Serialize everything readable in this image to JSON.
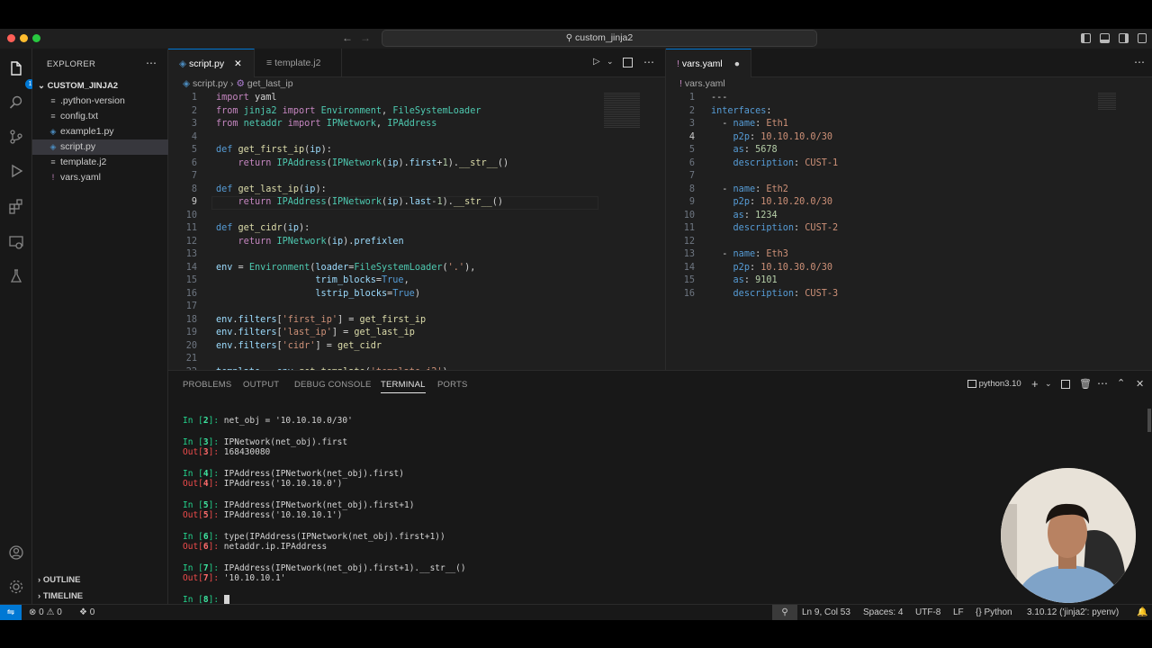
{
  "window": {
    "search_text": "custom_jinja2"
  },
  "explorer": {
    "title": "EXPLORER",
    "folder": "CUSTOM_JINJA2",
    "files": [
      ".python-version",
      "config.txt",
      "example1.py",
      "script.py",
      "template.j2",
      "vars.yaml"
    ],
    "selected": "script.py",
    "badge": "1",
    "outline": "OUTLINE",
    "timeline": "TIMELINE"
  },
  "left_editor": {
    "tabs": [
      "script.py",
      "template.j2"
    ],
    "breadcrumb_file": "script.py",
    "breadcrumb_symbol": "get_last_ip",
    "current_line": 9
  },
  "right_editor": {
    "tab": "vars.yaml",
    "breadcrumb_file": "vars.yaml",
    "current_line": 4
  },
  "panel": {
    "tabs": [
      "PROBLEMS",
      "OUTPUT",
      "DEBUG CONSOLE",
      "TERMINAL",
      "PORTS"
    ],
    "active_tab": "TERMINAL",
    "shell": "python3.10"
  },
  "terminal": [
    {
      "kind": "in",
      "n": "2",
      "code": "net_obj = '10.10.10.0/30'"
    },
    {
      "kind": "in",
      "n": "3",
      "code": "IPNetwork(net_obj).first"
    },
    {
      "kind": "out",
      "n": "3",
      "code": "168430080"
    },
    {
      "kind": "in",
      "n": "4",
      "code": "IPAddress(IPNetwork(net_obj).first)"
    },
    {
      "kind": "out",
      "n": "4",
      "code": "IPAddress('10.10.10.0')"
    },
    {
      "kind": "in",
      "n": "5",
      "code": "IPAddress(IPNetwork(net_obj).first+1)"
    },
    {
      "kind": "out",
      "n": "5",
      "code": "IPAddress('10.10.10.1')"
    },
    {
      "kind": "in",
      "n": "6",
      "code": "type(IPAddress(IPNetwork(net_obj).first+1))"
    },
    {
      "kind": "out",
      "n": "6",
      "code": "netaddr.ip.IPAddress"
    },
    {
      "kind": "in",
      "n": "7",
      "code": "IPAddress(IPNetwork(net_obj).first+1).__str__()"
    },
    {
      "kind": "out",
      "n": "7",
      "code": "'10.10.10.1'"
    },
    {
      "kind": "in",
      "n": "8",
      "code": ""
    }
  ],
  "statusbar": {
    "errors": "0",
    "warnings": "0",
    "ports": "0",
    "position": "Ln 9, Col 53",
    "spaces": "Spaces: 4",
    "encoding": "UTF-8",
    "eol": "LF",
    "language": "Python",
    "interpreter": "3.10.12 ('jinja2': pyenv)"
  },
  "colors": {
    "accent": "#0078d4",
    "background": "#1f1f1f",
    "sidebar": "#181818"
  }
}
